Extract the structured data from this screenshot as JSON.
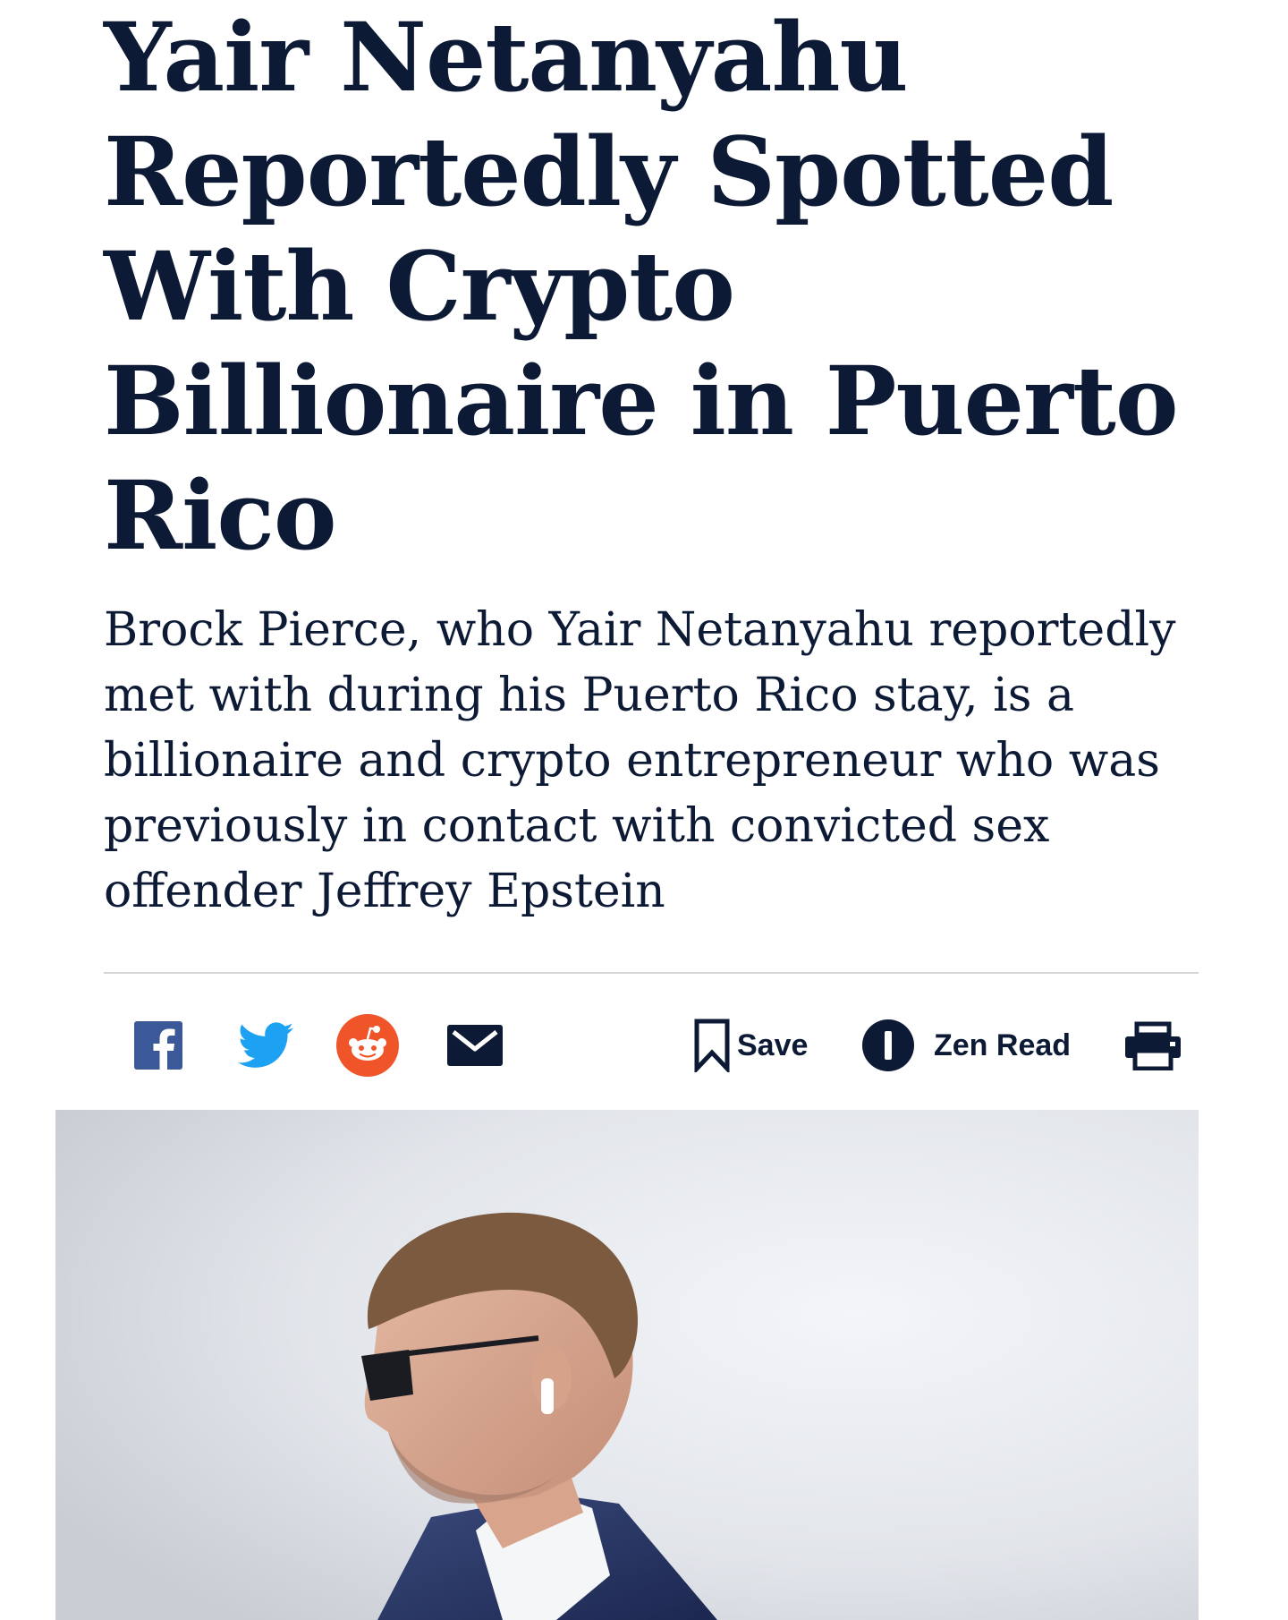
{
  "article": {
    "headline_lines": [
      "Yair Netanyahu",
      "Reportedly Spotted",
      "With Crypto",
      "Billionaire in Puerto",
      "Rico"
    ],
    "subhead_lines": [
      "Brock Pierce, who Yair Netanyahu reportedly",
      "met with during his Puerto Rico stay, is a",
      "billionaire and crypto entrepreneur who was",
      "previously in contact with convicted sex",
      "offender Jeffrey Epstein"
    ]
  },
  "share_bar": {
    "icons": {
      "facebook": "facebook-icon",
      "twitter": "twitter-icon",
      "reddit": "reddit-icon",
      "email": "email-icon",
      "bookmark": "bookmark-icon",
      "zen": "zen-read-icon",
      "print": "print-icon"
    },
    "save_label": "Save",
    "zen_read_label": "Zen Read"
  },
  "colors": {
    "text": "#0d1a35",
    "facebook": "#3b5998",
    "twitter": "#1da1f2",
    "reddit": "#f0552a",
    "divider": "#d6d6d6"
  }
}
